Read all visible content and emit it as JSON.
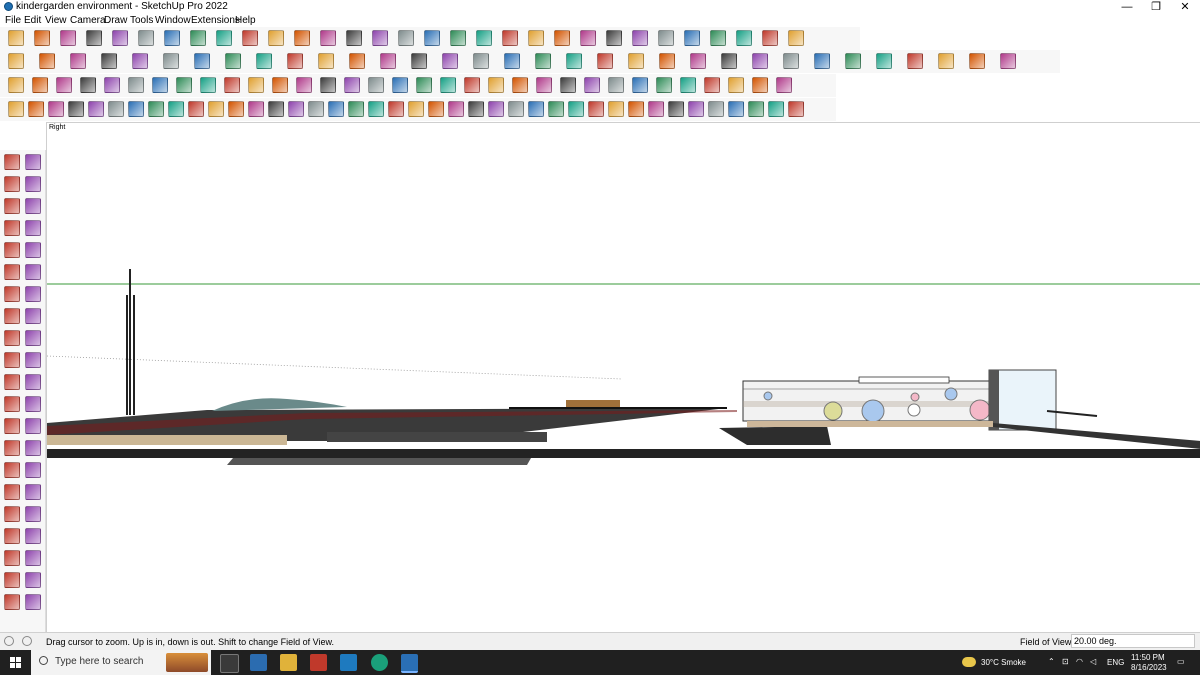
{
  "window": {
    "title": "kindergarden environment - SketchUp Pro 2022",
    "minimize_glyph": "—",
    "restore_glyph": "❐",
    "close_glyph": "✕"
  },
  "menu": [
    "File",
    "Edit",
    "View",
    "Camera",
    "Draw",
    "Tools",
    "Window",
    "Extensions",
    "Help"
  ],
  "viewport": {
    "scene_label": "Right",
    "camera_view": "Right"
  },
  "status": {
    "hint": "Drag cursor to zoom.  Up is in, down is out. Shift to change Field of View.",
    "measurement_label": "Field of View",
    "measurement_value": "20.00 deg."
  },
  "taskbar": {
    "search_placeholder": "Type here to search",
    "weather": "30°C  Smoke",
    "language": "ENG",
    "time": "11:50 PM",
    "date": "8/16/2023"
  },
  "colors": {
    "toolbar_bg": "#f7f7f7",
    "taskbar_bg": "#202020",
    "horizon_green": "#2e8b2e",
    "ground_dark": "#2b2b2b",
    "accent_red": "#c0392b",
    "icon_blue": "#2a6fb5"
  },
  "icons": {
    "row1": [
      "zoom-icon",
      "select-icon",
      "eraser-icon",
      "pencil-icon",
      "arc-icon",
      "rectangle-icon",
      "push-pull-icon",
      "follow-me-icon",
      "move-icon",
      "rotate-icon",
      "tape-measure-icon",
      "text-icon",
      "paint-bucket-icon",
      "orbit-icon",
      "pan-icon",
      "zoom-window-icon",
      "zoom-extents-icon",
      "component-icon",
      "sandbox-icon",
      "layers-icon",
      "styles-icon",
      "user-icon",
      "solid-tools-icon",
      "section-icon",
      "axes-icon",
      "walk-icon",
      "camera-icon",
      "position-camera-icon",
      "undo-icon",
      "redo-icon",
      "flag-icon"
    ],
    "row2": [
      "box-icon",
      "shaded-box-icon",
      "push-red-icon",
      "push-green-icon",
      "push-purple-icon",
      "arrow-down-icon",
      "scale-icon",
      "arc-tool-icon",
      "warehouse-icon",
      "extension-icon",
      "house-icon",
      "house-alt-icon",
      "house-outline-icon",
      "text-3d-icon",
      "link-icon",
      "pencil-red-icon",
      "shape-icon",
      "circle-icon",
      "hexagon-icon",
      "polygon-icon",
      "ring-icon",
      "arc-dual-icon",
      "wave-icon",
      "wave-alt-icon",
      "ellipse-icon",
      "torus-icon",
      "eraser-pink-icon",
      "paint-icon",
      "roof-icon",
      "cube-dark-icon",
      "render-icon",
      "model-icon",
      "settings-icon"
    ],
    "row3": [
      "blue-face-icon",
      "blue-cube-icon",
      "material-icon",
      "loop-icon",
      "fill-red-icon",
      "grid-icon",
      "frame-icon",
      "stairs-icon",
      "cylinder-icon",
      "dot-curve-icon",
      "red-cross-icon",
      "green-cross-icon",
      "x-icon",
      "cone-icon",
      "lock-icon",
      "loop-orange-icon",
      "refresh-icon",
      "target-icon",
      "box-brown-icon",
      "return-icon",
      "cube-green-icon",
      "cube-stack-icon",
      "cube-red-icon",
      "puzzle-icon",
      "square-icon",
      "palette-icon",
      "shuffle-icon",
      "tile-icon",
      "tile-alt-icon",
      "tile-red-icon",
      "arrows-icon",
      "curve-icon",
      "grid-alt-icon"
    ],
    "row4": [
      "move-arc-icon",
      "curve-dots-icon",
      "line-icon",
      "pipe-icon",
      "roof-a-icon",
      "roof-b-icon",
      "curve-a-icon",
      "curve-b-icon",
      "fillet-a-icon",
      "fillet-b-icon",
      "fillet-c-icon",
      "fillet-d-icon",
      "bevel-icon",
      "bevel-alt-icon",
      "chamfer-icon",
      "array-a-icon",
      "array-b-icon",
      "array-c-icon",
      "array-d-icon",
      "array-e-icon",
      "array-f-icon",
      "array-g-icon",
      "array-h-icon",
      "array-i-icon",
      "array-j-icon",
      "array-k-icon",
      "array-l-icon",
      "array-m-icon",
      "array-n-icon",
      "array-o-icon",
      "array-p-icon",
      "array-q-icon",
      "array-r-icon",
      "array-s-icon",
      "array-t-icon",
      "array-u-icon",
      "array-v-icon",
      "array-w-icon",
      "array-x-icon",
      "array-y-icon"
    ],
    "left": [
      "select-icon",
      "orbit-icon",
      "paint-bucket-icon",
      "eraser-icon",
      "component-icon",
      "pencil-icon",
      "line-icon",
      "freehand-icon",
      "rectangle-icon",
      "rotated-rect-icon",
      "circle-icon",
      "polygon-icon",
      "arc-icon",
      "pie-icon",
      "two-point-arc-icon",
      "three-point-arc-icon",
      "move-icon",
      "push-pull-icon",
      "rotate-icon",
      "follow-me-icon",
      "scale-icon",
      "offset-icon",
      "tape-measure-icon",
      "dimension-icon",
      "protractor-icon",
      "text-icon",
      "axes-icon",
      "3d-text-icon",
      "orbit-alt-icon",
      "pan-icon",
      "zoom-icon",
      "zoom-window-icon",
      "zoom-extents-icon",
      "previous-view-icon",
      "position-camera-icon",
      "look-around-icon",
      "walk-icon",
      "section-plane-icon",
      "sandbox-icon",
      "smoove-icon",
      "stamp-icon",
      "drape-icon"
    ]
  }
}
